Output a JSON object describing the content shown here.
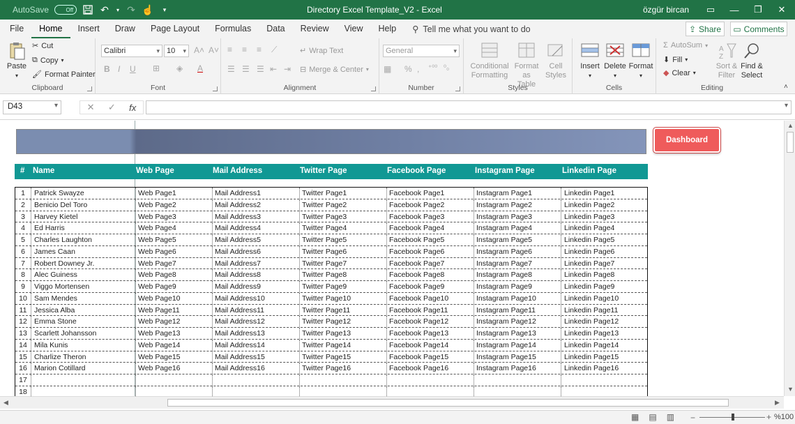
{
  "titlebar": {
    "autosave_label": "AutoSave",
    "autosave_state": "Off",
    "doc_title": "Directory Excel Template_V2  -  Excel",
    "user": "özgür bircan"
  },
  "tabs": [
    "File",
    "Home",
    "Insert",
    "Draw",
    "Page Layout",
    "Formulas",
    "Data",
    "Review",
    "View",
    "Help"
  ],
  "tellme": "Tell me what you want to do",
  "share": "Share",
  "comments": "Comments",
  "ribbon": {
    "clipboard": {
      "paste": "Paste",
      "cut": "Cut",
      "copy": "Copy",
      "format_painter": "Format Painter",
      "label": "Clipboard"
    },
    "font": {
      "name": "Calibri",
      "size": "10",
      "label": "Font"
    },
    "alignment": {
      "wrap": "Wrap Text",
      "merge": "Merge & Center",
      "label": "Alignment"
    },
    "number": {
      "format": "General",
      "label": "Number"
    },
    "styles": {
      "cond": "Conditional\nFormatting",
      "cond1": "Conditional",
      "cond2": "Formatting",
      "fmt1": "Format as",
      "fmt2": "Table",
      "cell1": "Cell",
      "cell2": "Styles",
      "label": "Styles"
    },
    "cells": {
      "insert": "Insert",
      "delete": "Delete",
      "format": "Format",
      "label": "Cells"
    },
    "editing": {
      "autosum": "AutoSum",
      "fill": "Fill",
      "clear": "Clear",
      "sort1": "Sort &",
      "sort2": "Filter",
      "find1": "Find &",
      "find2": "Select",
      "label": "Editing"
    }
  },
  "formula_bar": {
    "name_box": "D43",
    "fx": "fx"
  },
  "dashboard_button": "Dashboard",
  "headers": [
    "#",
    "Name",
    "Web Page",
    "Mail Address",
    "Twitter Page",
    "Facebook Page",
    "Instagram Page",
    "Linkedin Page"
  ],
  "rows": [
    {
      "n": "1",
      "name": "Patrick Swayze",
      "web": "Web Page1",
      "mail": "Mail Address1",
      "tw": "Twitter Page1",
      "fb": "Facebook Page1",
      "ig": "Instagram Page1",
      "li": "Linkedin Page1"
    },
    {
      "n": "2",
      "name": "Benicio Del Toro",
      "web": "Web Page2",
      "mail": "Mail Address2",
      "tw": "Twitter Page2",
      "fb": "Facebook Page2",
      "ig": "Instagram Page2",
      "li": "Linkedin Page2"
    },
    {
      "n": "3",
      "name": "Harvey Kietel",
      "web": "Web Page3",
      "mail": "Mail Address3",
      "tw": "Twitter Page3",
      "fb": "Facebook Page3",
      "ig": "Instagram Page3",
      "li": "Linkedin Page3"
    },
    {
      "n": "4",
      "name": "Ed Harris",
      "web": "Web Page4",
      "mail": "Mail Address4",
      "tw": "Twitter Page4",
      "fb": "Facebook Page4",
      "ig": "Instagram Page4",
      "li": "Linkedin Page4"
    },
    {
      "n": "5",
      "name": "Charles Laughton",
      "web": "Web Page5",
      "mail": "Mail Address5",
      "tw": "Twitter Page5",
      "fb": "Facebook Page5",
      "ig": "Instagram Page5",
      "li": "Linkedin Page5"
    },
    {
      "n": "6",
      "name": "James Caan",
      "web": "Web Page6",
      "mail": "Mail Address6",
      "tw": "Twitter Page6",
      "fb": "Facebook Page6",
      "ig": "Instagram Page6",
      "li": "Linkedin Page6"
    },
    {
      "n": "7",
      "name": "Robert Downey Jr.",
      "web": "Web Page7",
      "mail": "Mail Address7",
      "tw": "Twitter Page7",
      "fb": "Facebook Page7",
      "ig": "Instagram Page7",
      "li": "Linkedin Page7"
    },
    {
      "n": "8",
      "name": "Alec Guiness",
      "web": "Web Page8",
      "mail": "Mail Address8",
      "tw": "Twitter Page8",
      "fb": "Facebook Page8",
      "ig": "Instagram Page8",
      "li": "Linkedin Page8"
    },
    {
      "n": "9",
      "name": "Viggo Mortensen",
      "web": "Web Page9",
      "mail": "Mail Address9",
      "tw": "Twitter Page9",
      "fb": "Facebook Page9",
      "ig": "Instagram Page9",
      "li": "Linkedin Page9"
    },
    {
      "n": "10",
      "name": "Sam Mendes",
      "web": "Web Page10",
      "mail": "Mail Address10",
      "tw": "Twitter Page10",
      "fb": "Facebook Page10",
      "ig": "Instagram Page10",
      "li": "Linkedin Page10"
    },
    {
      "n": "11",
      "name": "Jessica Alba",
      "web": "Web Page11",
      "mail": "Mail Address11",
      "tw": "Twitter Page11",
      "fb": "Facebook Page11",
      "ig": "Instagram Page11",
      "li": "Linkedin Page11"
    },
    {
      "n": "12",
      "name": "Emma Stone",
      "web": "Web Page12",
      "mail": "Mail Address12",
      "tw": "Twitter Page12",
      "fb": "Facebook Page12",
      "ig": "Instagram Page12",
      "li": "Linkedin Page12"
    },
    {
      "n": "13",
      "name": "Scarlett Johansson",
      "web": "Web Page13",
      "mail": "Mail Address13",
      "tw": "Twitter Page13",
      "fb": "Facebook Page13",
      "ig": "Instagram Page13",
      "li": "Linkedin Page13"
    },
    {
      "n": "14",
      "name": "Mila Kunis",
      "web": "Web Page14",
      "mail": "Mail Address14",
      "tw": "Twitter Page14",
      "fb": "Facebook Page14",
      "ig": "Instagram Page14",
      "li": "Linkedin Page14"
    },
    {
      "n": "15",
      "name": "Charlize Theron",
      "web": "Web Page15",
      "mail": "Mail Address15",
      "tw": "Twitter Page15",
      "fb": "Facebook Page15",
      "ig": "Instagram Page15",
      "li": "Linkedin Page15"
    },
    {
      "n": "16",
      "name": "Marion Cotillard",
      "web": "Web Page16",
      "mail": "Mail Address16",
      "tw": "Twitter Page16",
      "fb": "Facebook Page16",
      "ig": "Instagram Page16",
      "li": "Linkedin Page16"
    },
    {
      "n": "17",
      "name": "",
      "web": "",
      "mail": "",
      "tw": "",
      "fb": "",
      "ig": "",
      "li": ""
    },
    {
      "n": "18",
      "name": "",
      "web": "",
      "mail": "",
      "tw": "",
      "fb": "",
      "ig": "",
      "li": ""
    }
  ],
  "zoom": "%100",
  "colors": {
    "excel_green": "#217346",
    "header_teal": "#119894",
    "dashboard_red": "#ef5b5b",
    "banner_blue": "#6f7fa3"
  }
}
